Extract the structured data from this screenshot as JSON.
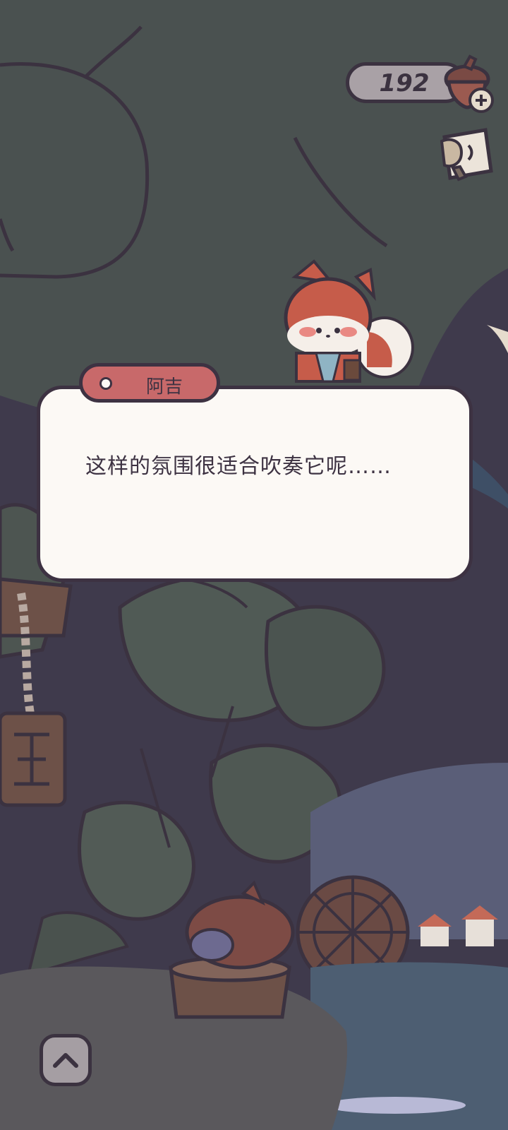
{
  "hud": {
    "acorn_count": "192",
    "acorn_icon": "acorn-plus-icon",
    "journal_icon": "journal-scroll-icon"
  },
  "dialog": {
    "speaker": "阿吉",
    "text": "这样的氛围很适合吹奏它呢……"
  },
  "controls": {
    "expand_icon": "chevron-up-icon"
  },
  "colors": {
    "dialog_bg": "#fcf9f5",
    "speaker_tag": "#c8696a",
    "outline": "#3d3242"
  }
}
